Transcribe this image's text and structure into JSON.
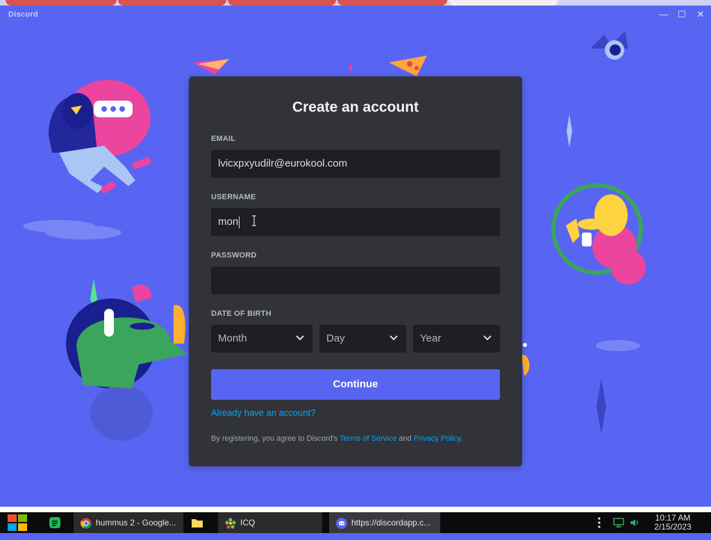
{
  "window": {
    "title": "Discord",
    "controls": {
      "minimize": "—",
      "maximize": "☐",
      "close": "✕"
    }
  },
  "form": {
    "title": "Create an account",
    "email": {
      "label": "EMAIL",
      "value": "lvicxpxyudilr@eurokool.com"
    },
    "username": {
      "label": "USERNAME",
      "value": "mon"
    },
    "password": {
      "label": "PASSWORD",
      "value": ""
    },
    "dob": {
      "label": "DATE OF BIRTH",
      "month": "Month",
      "day": "Day",
      "year": "Year"
    },
    "continue_label": "Continue",
    "login_link": "Already have an account?",
    "legal": {
      "prefix": "By registering, you agree to Discord's ",
      "terms": "Terms of Service",
      "and": " and ",
      "privacy": "Privacy Policy",
      "suffix": "."
    }
  },
  "taskbar": {
    "items": [
      {
        "label": "hummus 2 - Google...",
        "icon": "chrome-icon"
      },
      {
        "label": "",
        "icon": "folder-icon"
      },
      {
        "label": "ICQ",
        "icon": "icq-icon"
      },
      {
        "label": "https://discordapp.c...",
        "icon": "discord-icon"
      }
    ],
    "clock": {
      "time": "10:17 AM",
      "date": "2/15/2023"
    }
  },
  "colors": {
    "blurple": "#5865f2",
    "card": "#313338",
    "input": "#1e1f22",
    "link": "#00a8fc"
  }
}
